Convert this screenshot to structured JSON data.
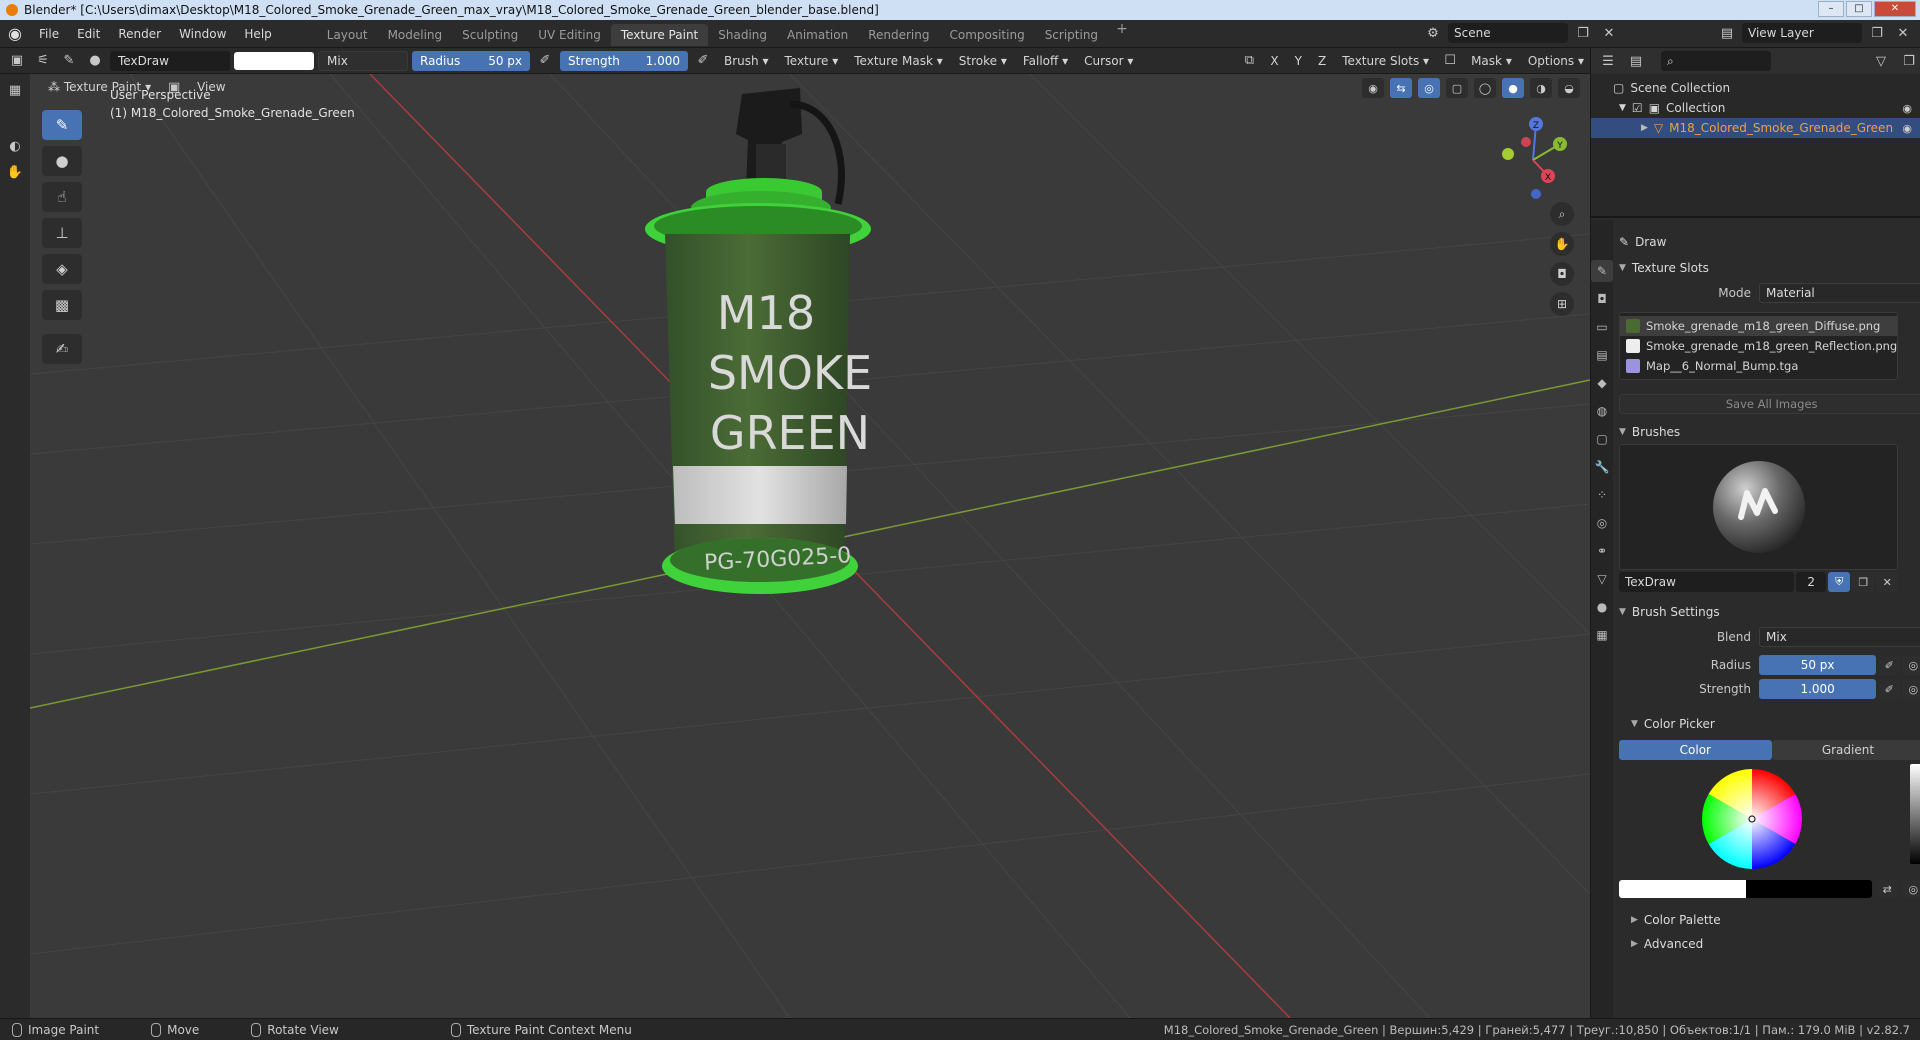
{
  "window": {
    "title": "Blender* [C:\\Users\\dimax\\Desktop\\M18_Colored_Smoke_Grenade_Green_max_vray\\M18_Colored_Smoke_Grenade_Green_blender_base.blend]",
    "min": "–",
    "max": "□",
    "close": "✕"
  },
  "menu": [
    "File",
    "Edit",
    "Render",
    "Window",
    "Help"
  ],
  "workspaces": [
    "Layout",
    "Modeling",
    "Sculpting",
    "UV Editing",
    "Texture Paint",
    "Shading",
    "Animation",
    "Rendering",
    "Compositing",
    "Scripting"
  ],
  "workspace_add": "+",
  "scene": {
    "name": "Scene",
    "view_layer": "View Layer"
  },
  "toolheader": {
    "brush_name": "TexDraw",
    "blend": "Mix",
    "radius_label": "Radius",
    "radius_value": "50 px",
    "strength_label": "Strength",
    "strength_value": "1.000",
    "menus": [
      "Brush",
      "Texture",
      "Texture Mask",
      "Stroke",
      "Falloff",
      "Cursor"
    ],
    "axes": [
      "X",
      "Y",
      "Z"
    ],
    "texture_slots": "Texture Slots",
    "mask": "Mask",
    "options": "Options"
  },
  "subheader": {
    "mode": "Texture Paint",
    "view": "View"
  },
  "viewport": {
    "perspective": "User Perspective",
    "object": "(1) M18_Colored_Smoke_Grenade_Green",
    "can_text": [
      "M18",
      "SMOKE",
      "GREEN"
    ],
    "can_code": "PG-70G025-0",
    "gizmo": {
      "x": "X",
      "y": "Y",
      "z": "Z"
    }
  },
  "outliner": {
    "scene_collection": "Scene Collection",
    "collection": "Collection",
    "object": "M18_Colored_Smoke_Grenade_Green"
  },
  "properties": {
    "tool": "Draw",
    "texture_slots_title": "Texture Slots",
    "mode_label": "Mode",
    "mode_value": "Material",
    "slots": [
      {
        "name": "Smoke_grenade_m18_green_Diffuse.png",
        "color": "#4b6a32"
      },
      {
        "name": "Smoke_grenade_m18_green_Reflection.png",
        "color": "#eeeeee"
      },
      {
        "name": "Map__6_Normal_Bump.tga",
        "color": "#9c93e0"
      }
    ],
    "save_all": "Save All Images",
    "brushes_title": "Brushes",
    "brush_name": "TexDraw",
    "brush_users": "2",
    "brush_settings_title": "Brush Settings",
    "blend_label": "Blend",
    "blend_value": "Mix",
    "radius_label": "Radius",
    "radius_value": "50 px",
    "strength_label": "Strength",
    "strength_value": "1.000",
    "color_picker_title": "Color Picker",
    "color_tab": "Color",
    "gradient_tab": "Gradient",
    "color_palette_title": "Color Palette",
    "advanced_title": "Advanced"
  },
  "status": {
    "items": [
      "Image Paint",
      "Move",
      "Rotate View",
      "Texture Paint Context Menu"
    ],
    "right": "M18_Colored_Smoke_Grenade_Green | Вершин:5,429 | Граней:5,477 | Треуг.:10,850 | Объектов:1/1 | Пам.: 179.0 MiB | v2.82.7"
  },
  "colors": {
    "accent": "#4772b3",
    "can_body": "#4a6a34",
    "can_rim": "#3fd23a",
    "grid_red": "#a83c3c",
    "grid_green": "#7a9a34"
  }
}
